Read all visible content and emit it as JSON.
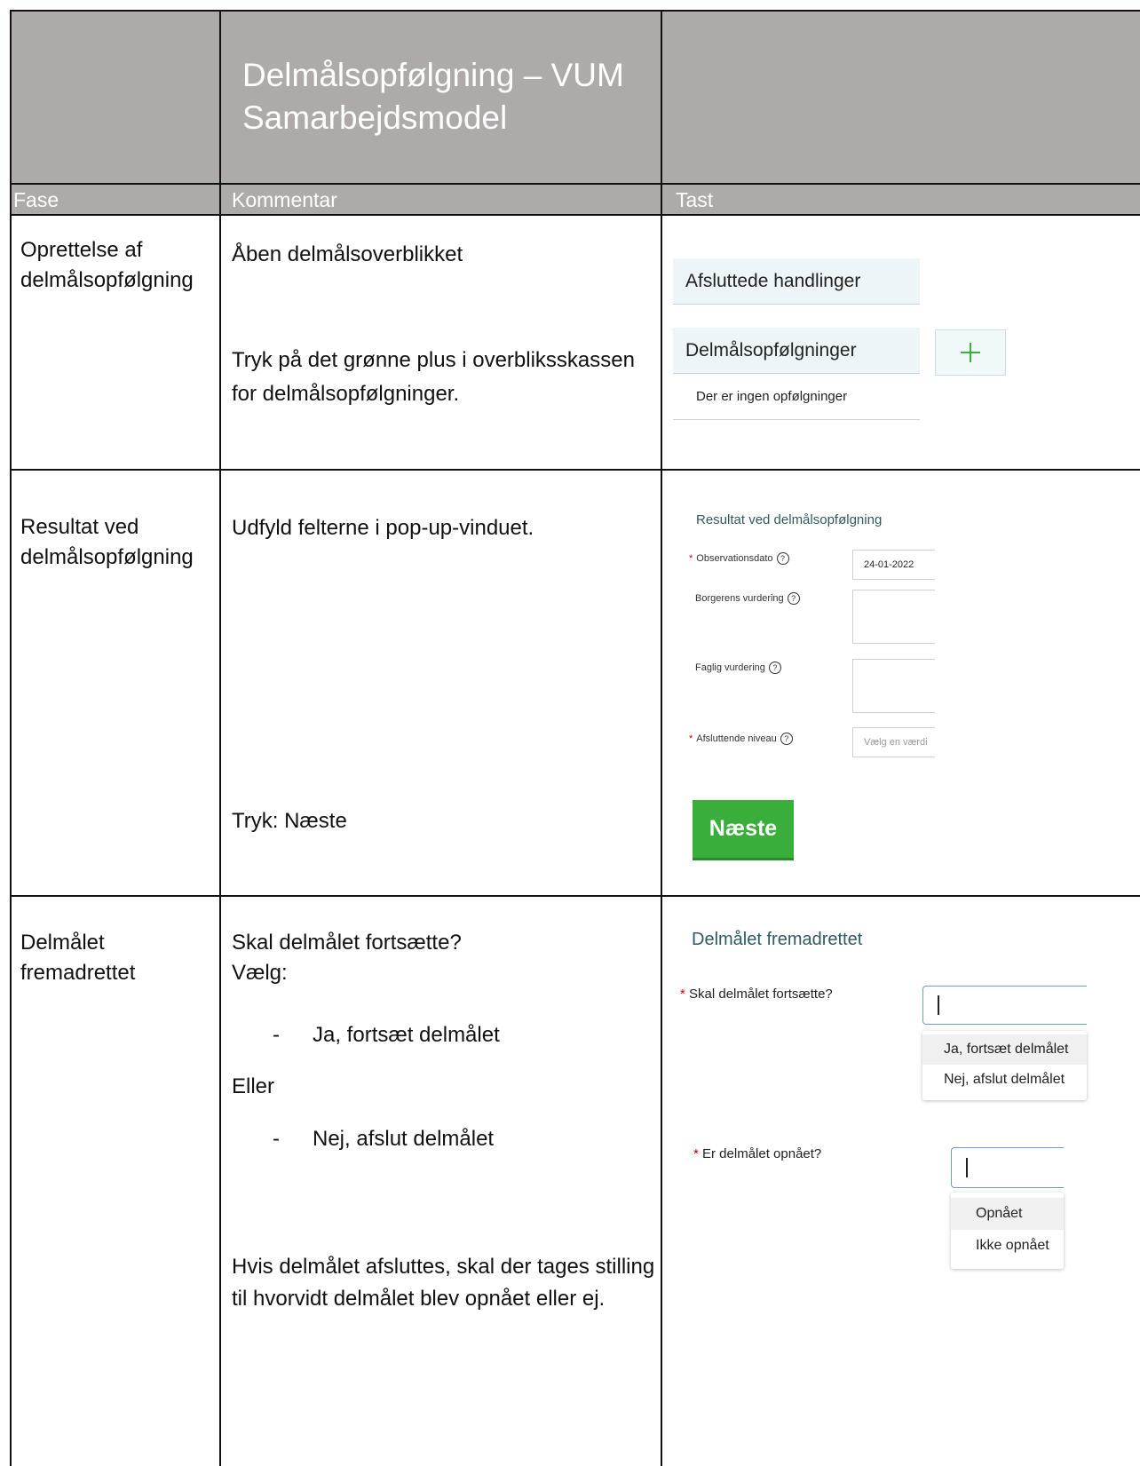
{
  "title": "Delmålsopfølgning – VUM Samarbejdsmodel",
  "headers": {
    "fase": "Fase",
    "kommentar": "Kommentar",
    "tast": "Tast"
  },
  "rows": [
    {
      "fase": "Oprettelse af delmålsopfølgning",
      "comments": [
        "Åben delmålsoverblikket",
        "Tryk på det grønne plus i overbliksskassen for delmålsopfølgninger."
      ],
      "ui": {
        "panel1": "Afsluttede handlinger",
        "panel2": "Delmålsopfølgninger",
        "panel2_body": "Der er ingen opfølgninger"
      }
    },
    {
      "fase": "Resultat ved delmålsopfølgning",
      "comments": [
        "Udfyld felterne i pop-up-vinduet.",
        "Tryk: Næste"
      ],
      "ui": {
        "section": "Resultat ved delmålsopfølgning",
        "observationsdato_label": "Observationsdato",
        "observationsdato_value": "24-01-2022",
        "borgerens_label": "Borgerens vurdering",
        "faglig_label": "Faglig vurdering",
        "niveau_label": "Afsluttende niveau",
        "niveau_placeholder": "Vælg en værdi",
        "next_button": "Næste"
      }
    },
    {
      "fase": "Delmålet fremadrettet",
      "comments": {
        "question": "Skal delmålet fortsætte?",
        "choose": "Vælg:",
        "option1": "Ja, fortsæt delmålet",
        "or": "Eller",
        "option2": "Nej, afslut delmålet",
        "note": "Hvis delmålet afsluttes, skal der tages stilling til hvorvidt delmålet blev opnået eller ej."
      },
      "ui": {
        "section": "Delmålet fremadrettet",
        "q1_label": "Skal delmålet fortsætte?",
        "q1_options": [
          "Ja, fortsæt delmålet",
          "Nej, afslut delmålet"
        ],
        "q2_label": "Er delmålet opnået?",
        "q2_options": [
          "Opnået",
          "Ikke opnået"
        ]
      }
    }
  ],
  "bullet": "-",
  "required_mark": "*",
  "help_mark": "?",
  "plus_icon": "plus-icon",
  "colors": {
    "header_bg": "#aeaaaa",
    "green": "#3aae3a",
    "section_text": "#2f5a5f"
  }
}
